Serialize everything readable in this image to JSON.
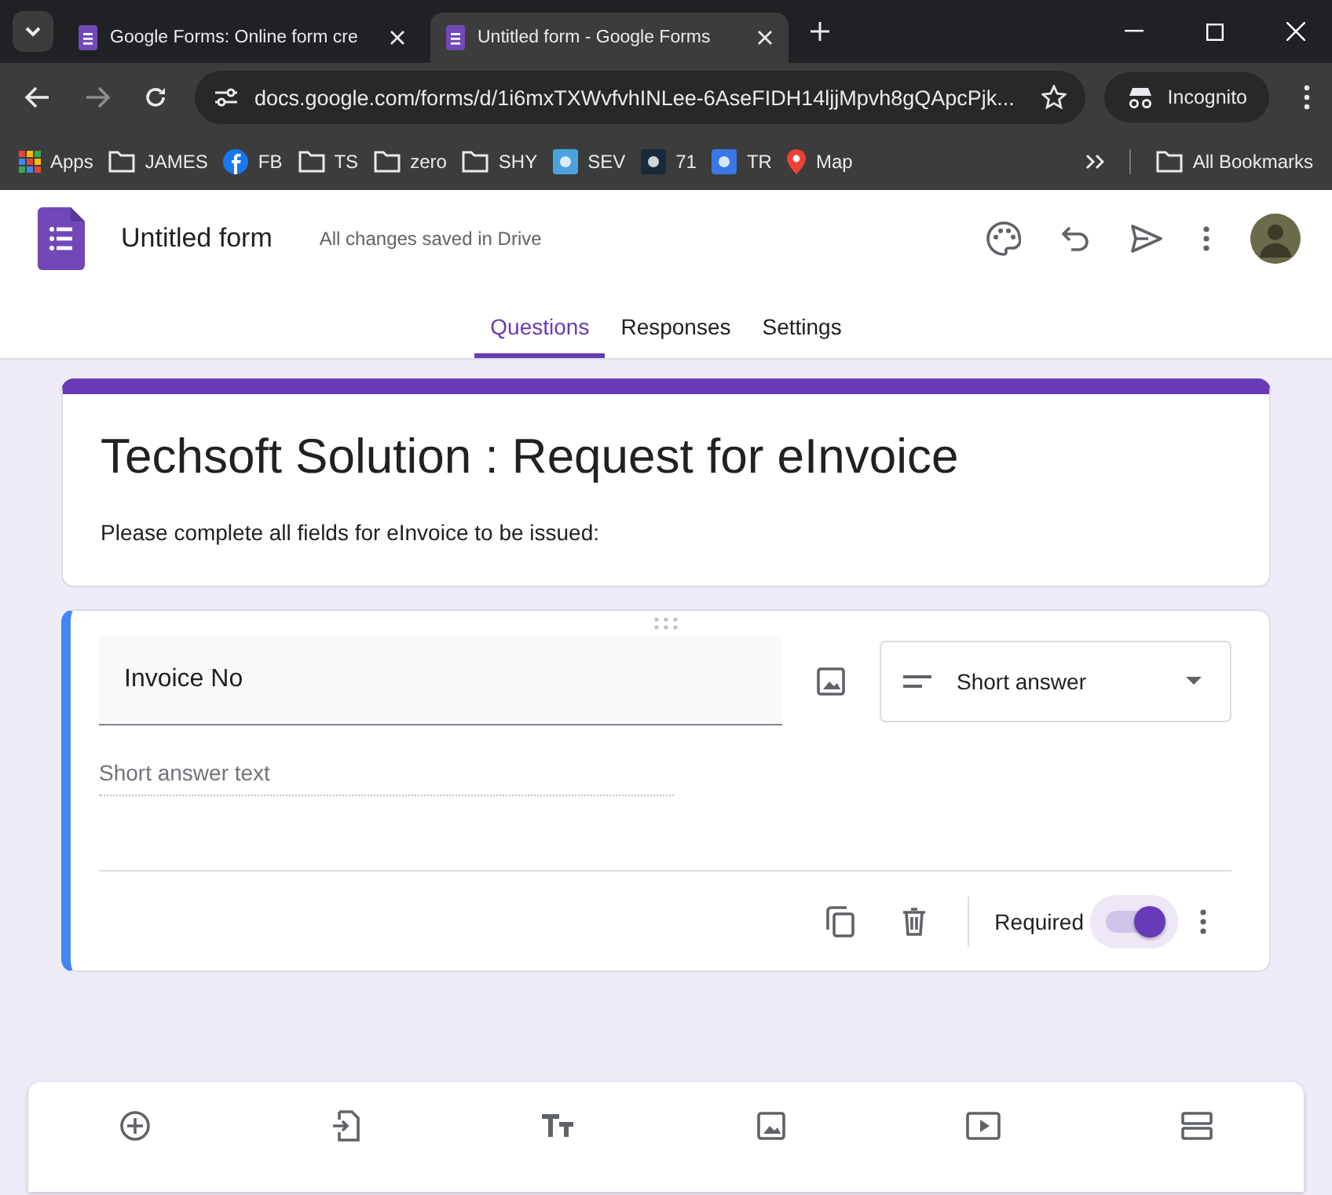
{
  "browser": {
    "tabs": [
      {
        "title": "Google Forms: Online form cre",
        "selected": false
      },
      {
        "title": "Untitled form - Google Forms",
        "selected": true
      }
    ],
    "url": "docs.google.com/forms/d/1i6mxTXWvfvhINLee-6AseFIDH14ljjMpvh8gQApcPjk...",
    "profile": "Incognito",
    "bookmarks": [
      {
        "kind": "apps",
        "label": "Apps"
      },
      {
        "kind": "folder",
        "label": "JAMES"
      },
      {
        "kind": "fb",
        "label": "FB"
      },
      {
        "kind": "folder",
        "label": "TS"
      },
      {
        "kind": "folder",
        "label": "zero"
      },
      {
        "kind": "folder",
        "label": "SHY"
      },
      {
        "kind": "site",
        "label": "SEV",
        "color": "#4aa3df"
      },
      {
        "kind": "site",
        "label": "71",
        "color": "#1b2a3a"
      },
      {
        "kind": "site",
        "label": "TR",
        "color": "#3b78e7"
      },
      {
        "kind": "map",
        "label": "Map"
      }
    ],
    "all_bookmarks": "All Bookmarks"
  },
  "header": {
    "title": "Untitled form",
    "status": "All changes saved in Drive"
  },
  "tabs": [
    {
      "label": "Questions",
      "selected": true
    },
    {
      "label": "Responses",
      "selected": false
    },
    {
      "label": "Settings",
      "selected": false
    }
  ],
  "form": {
    "title": "Techsoft Solution : Request for eInvoice",
    "description": "Please complete all fields for eInvoice to be issued:"
  },
  "question": {
    "title": "Invoice No",
    "type": "Short answer",
    "placeholder": "Short answer text",
    "required_label": "Required",
    "required": true
  }
}
